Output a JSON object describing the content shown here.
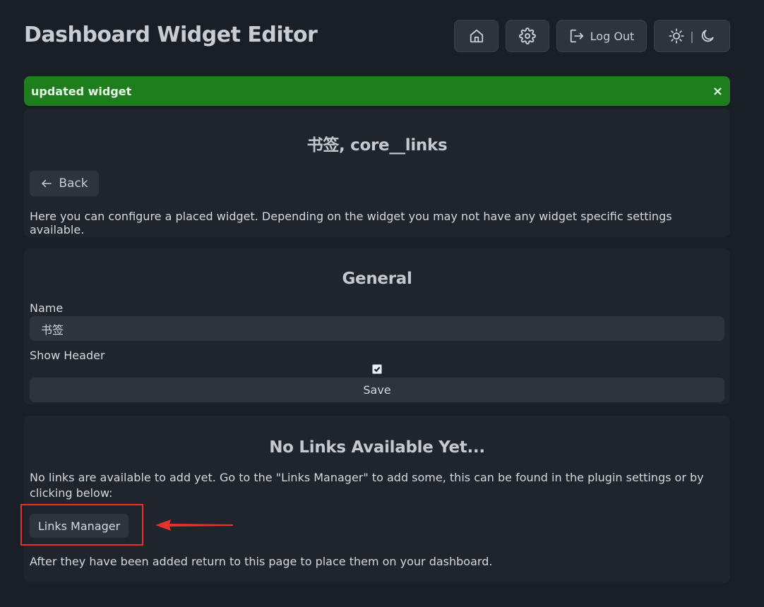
{
  "header": {
    "title": "Dashboard Widget Editor",
    "home_icon": "home-icon",
    "settings_icon": "gear-icon",
    "logout_label": "Log Out",
    "theme_separator": "|"
  },
  "alert": {
    "message": "updated widget",
    "close": "×",
    "color": "#1e7e1e"
  },
  "widget_card": {
    "title": "书签, core__links",
    "back_label": "Back",
    "description": "Here you can configure a placed widget. Depending on the widget you may not have any widget specific settings available."
  },
  "general_card": {
    "title": "General",
    "name_label": "Name",
    "name_value": "书签",
    "show_header_label": "Show Header",
    "show_header_checked": true,
    "save_label": "Save"
  },
  "links_card": {
    "title": "No Links Available Yet...",
    "description": "No links are available to add yet. Go to the \"Links Manager\" to add some, this can be found in the plugin settings or by clicking below:",
    "links_manager_label": "Links Manager",
    "after_text": "After they have been added return to this page to place them on your dashboard."
  },
  "annotation": {
    "color": "#e8312a"
  }
}
